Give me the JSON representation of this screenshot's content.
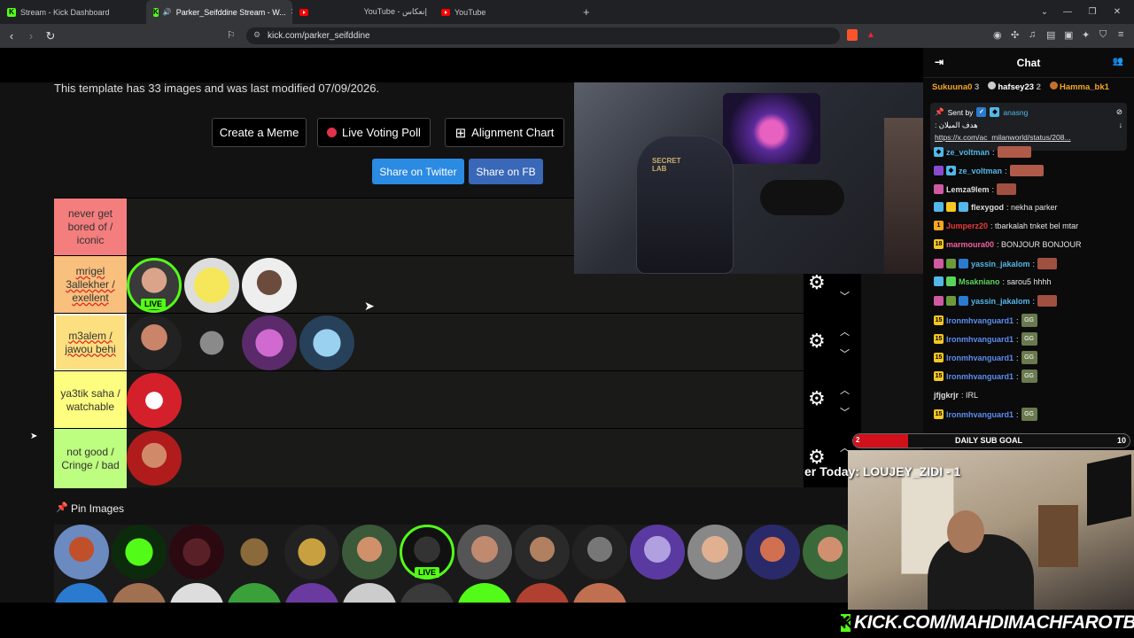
{
  "browser": {
    "tabs": [
      {
        "label": "Stream - Kick Dashboard",
        "icon": "kick-icon"
      },
      {
        "label": "Parker_Seifddine Stream - W...",
        "icon": "kick-icon",
        "active": true
      },
      {
        "label": "",
        "icon": "youtube-icon"
      },
      {
        "label": "YouTube - إنعكاس",
        "icon": ""
      },
      {
        "label": "YouTube",
        "icon": "youtube-icon"
      }
    ],
    "url": "kick.com/parker_seifddine"
  },
  "page": {
    "template_info": "This template has 33 images and was last modified 07/09/2026.",
    "buttons": {
      "create_meme": "Create a Meme",
      "live_voting_poll": "Live Voting Poll",
      "alignment_chart": "Alignment Chart",
      "share_twitter": "Share on Twitter",
      "share_fb": "Share on FB"
    },
    "tiers": [
      {
        "label": "never get bored of / iconic",
        "color": "#f47d7d"
      },
      {
        "label": "mrigel 3allekher / exellent",
        "color": "#f9bf7d"
      },
      {
        "label": "m3alem / jawou behi",
        "color": "#fcdf7f"
      },
      {
        "label": "ya3tik saha / watchable",
        "color": "#fdfd7f"
      },
      {
        "label": "not good / Cringe / bad",
        "color": "#bdfd7f"
      }
    ],
    "live_badge": "LIVE",
    "pin_label": "Pin Images"
  },
  "chat": {
    "title": "Chat",
    "leaderboard": [
      {
        "name": "Sukuuna0",
        "count": "3",
        "color": "#f6a623"
      },
      {
        "name": "hafsey23",
        "count": "2",
        "color": "#ffffff"
      },
      {
        "name": "Hamma_bk1",
        "count": "",
        "color": "#f6a623"
      }
    ],
    "pinned": {
      "sent_by": "Sent by",
      "sender": "anasng",
      "text": "هدف الميلان :",
      "link": "https://x.com/ac_milanworld/status/208..."
    },
    "messages": [
      {
        "user": "ze_voltman",
        "text": ":",
        "color": "#53b7e8"
      },
      {
        "user": "ze_voltman",
        "text": ":",
        "color": "#53b7e8"
      },
      {
        "user": "Lemza9lem",
        "text": ":",
        "color": "#dddddd"
      },
      {
        "user": "flexygod",
        "text": ": nekha parker",
        "color": "#dddddd"
      },
      {
        "user": "Jumperz20",
        "text": ": tbarkalah tnket bel mtar",
        "color": "#e83a3a"
      },
      {
        "user": "marmoura00",
        "text": ": BONJOUR BONJOUR",
        "color": "#f060a0"
      },
      {
        "user": "yassin_jakalom",
        "text": ":",
        "color": "#53b7e8"
      },
      {
        "user": "Msakniano",
        "text": ": sarou5 hhhh",
        "color": "#5ad35a"
      },
      {
        "user": "yassin_jakalom",
        "text": ":",
        "color": "#53b7e8"
      },
      {
        "user": "Ironmhvanguard1",
        "text": ":",
        "color": "#5c8cf0"
      },
      {
        "user": "Ironmhvanguard1",
        "text": ":",
        "color": "#5c8cf0"
      },
      {
        "user": "Ironmhvanguard1",
        "text": ":",
        "color": "#5c8cf0"
      },
      {
        "user": "Ironmhvanguard1",
        "text": ":",
        "color": "#5c8cf0"
      },
      {
        "user": "jfjgkrjr",
        "text": ": IRL",
        "color": "#dddddd"
      },
      {
        "user": "Ironmhvanguard1",
        "text": ":",
        "color": "#5c8cf0"
      }
    ]
  },
  "overlay": {
    "sub_goal_label": "DAILY SUB GOAL",
    "sub_goal_current": "2",
    "sub_goal_target": "10",
    "sub_goal_fraction": 0.2,
    "top_donor": "er Today: LOUJEY_ZIDI - 1",
    "kick_url": "KICK.COM/MAHDIMACHFAROTB"
  }
}
